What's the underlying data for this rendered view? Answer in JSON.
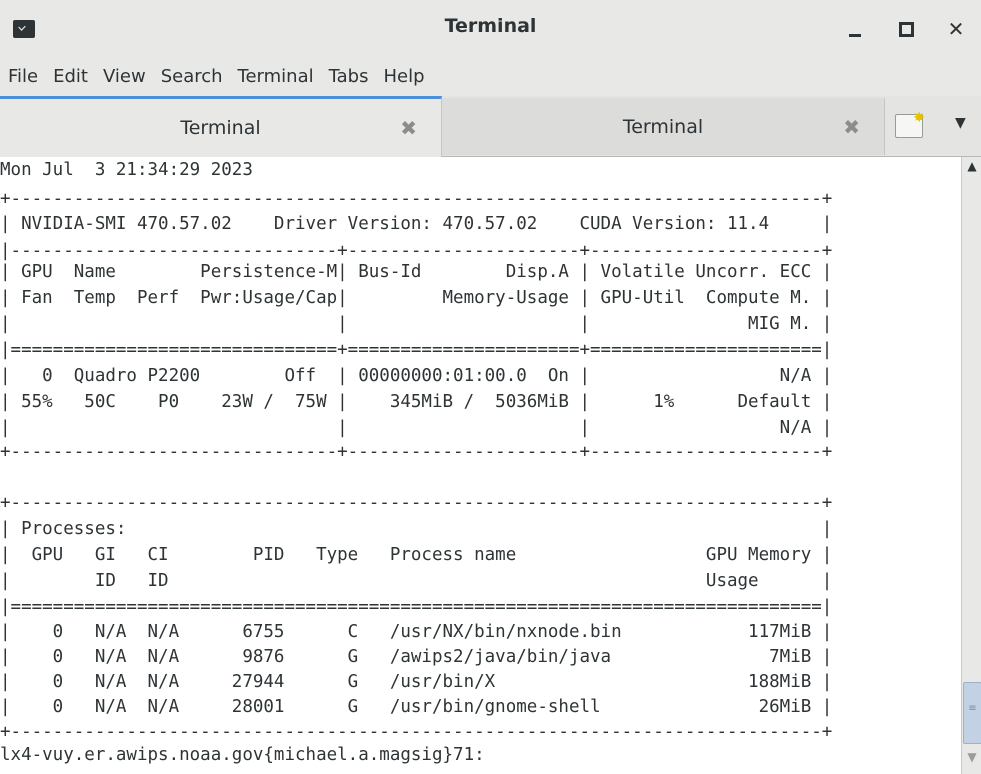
{
  "window": {
    "title": "Terminal",
    "minimize_icon": "minimize-icon",
    "maximize_icon": "maximize-icon",
    "close_icon": "close-icon"
  },
  "menu": [
    "File",
    "Edit",
    "View",
    "Search",
    "Terminal",
    "Tabs",
    "Help"
  ],
  "tabs": [
    {
      "label": "Terminal",
      "active": true
    },
    {
      "label": "Terminal",
      "active": false
    }
  ],
  "terminal": {
    "lines": [
      "Mon Jul  3 21:34:29 2023",
      "+-----------------------------------------------------------------------------+",
      "| NVIDIA-SMI 470.57.02    Driver Version: 470.57.02    CUDA Version: 11.4     |",
      "|-------------------------------+----------------------+----------------------+",
      "| GPU  Name        Persistence-M| Bus-Id        Disp.A | Volatile Uncorr. ECC |",
      "| Fan  Temp  Perf  Pwr:Usage/Cap|         Memory-Usage | GPU-Util  Compute M. |",
      "|                               |                      |               MIG M. |",
      "|===============================+======================+======================|",
      "|   0  Quadro P2200        Off  | 00000000:01:00.0  On |                  N/A |",
      "| 55%   50C    P0    23W /  75W |    345MiB /  5036MiB |      1%      Default |",
      "|                               |                      |                  N/A |",
      "+-------------------------------+----------------------+----------------------+",
      "",
      "+-----------------------------------------------------------------------------+",
      "| Processes:                                                                  |",
      "|  GPU   GI   CI        PID   Type   Process name                  GPU Memory |",
      "|        ID   ID                                                   Usage      |",
      "|=============================================================================|",
      "|    0   N/A  N/A      6755      C   /usr/NX/bin/nxnode.bin            117MiB |",
      "|    0   N/A  N/A      9876      G   /awips2/java/bin/java               7MiB |",
      "|    0   N/A  N/A     27944      G   /usr/bin/X                        188MiB |",
      "|    0   N/A  N/A     28001      G   /usr/bin/gnome-shell               26MiB |",
      "+-----------------------------------------------------------------------------+",
      "lx4-vuy.er.awips.noaa.gov{michael.a.magsig}71: "
    ]
  },
  "colors": {
    "window_bg": "#e8e8e7",
    "terminal_bg": "#ffffff",
    "terminal_fg": "#2e3436",
    "active_tab_accent": "#4a90d9",
    "scroll_thumb": "#c3d1e4"
  }
}
